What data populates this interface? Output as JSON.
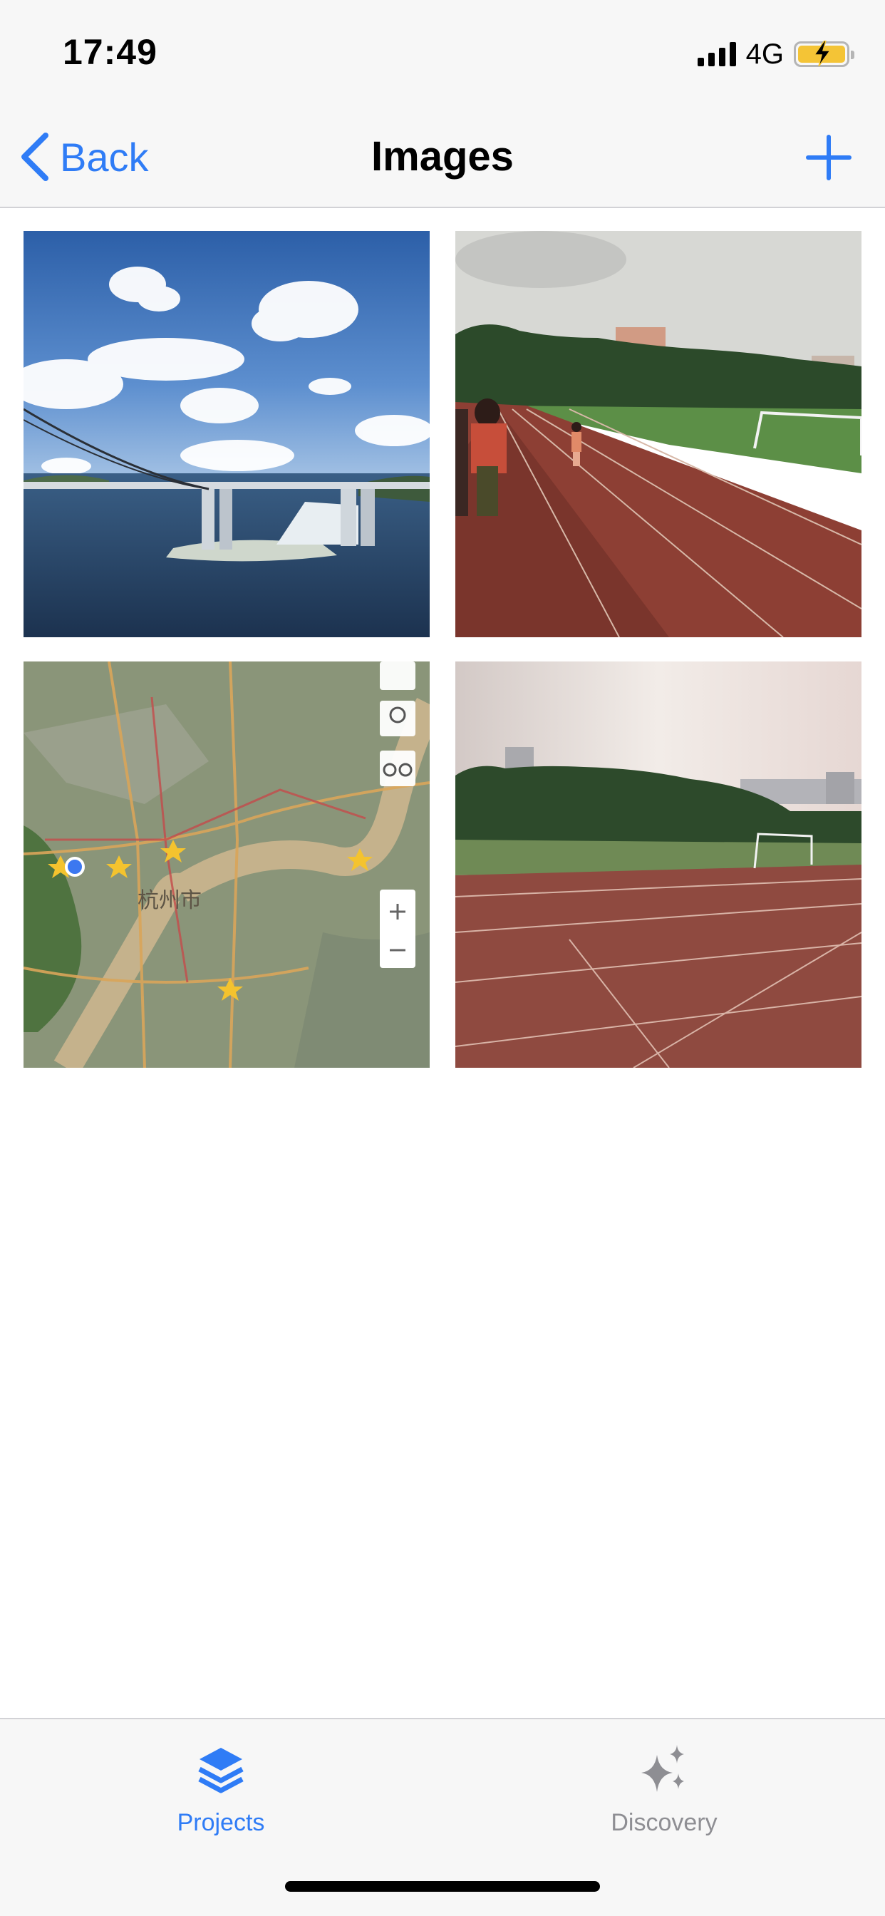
{
  "status_bar": {
    "time": "17:49",
    "network": "4G",
    "icons": [
      "signal-icon",
      "battery-charging-icon"
    ]
  },
  "nav": {
    "back_label": "Back",
    "title": "Images",
    "add_icon": "plus-icon"
  },
  "images": [
    {
      "name": "bridge-over-bay-photo"
    },
    {
      "name": "running-track-with-people-photo"
    },
    {
      "name": "city-satellite-map-photo",
      "map_label": "杭州市"
    },
    {
      "name": "empty-running-track-photo"
    }
  ],
  "tabs": [
    {
      "label": "Projects",
      "icon": "layers-icon",
      "selected": true,
      "color": "#2f7cf6"
    },
    {
      "label": "Discovery",
      "icon": "sparkles-icon",
      "selected": false,
      "color": "#8e8e93"
    }
  ],
  "colors": {
    "accent": "#2f7cf6",
    "bar_background": "#f7f7f7",
    "battery": "#f4c436"
  }
}
